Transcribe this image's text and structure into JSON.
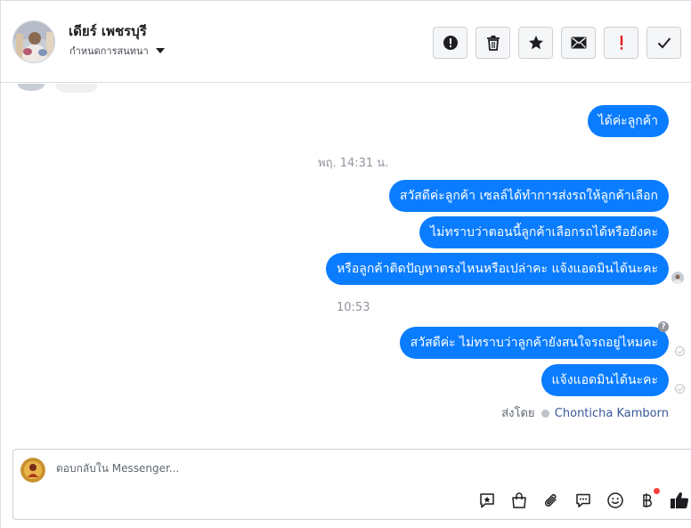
{
  "header": {
    "contact_name": "เดียร์ เพชรบุรี",
    "assign_label": "กำหนดการสนทนา",
    "toolbar": [
      {
        "name": "spam-button",
        "icon": "exclamation-circle-icon"
      },
      {
        "name": "delete-button",
        "icon": "trash-icon"
      },
      {
        "name": "star-button",
        "icon": "star-icon"
      },
      {
        "name": "mark-unread-button",
        "icon": "envelope-icon"
      },
      {
        "name": "important-button",
        "icon": "red-exclamation-icon"
      },
      {
        "name": "done-button",
        "icon": "checkmark-icon"
      }
    ]
  },
  "messages": [
    {
      "text": "ได้ค่ะลูกค้า",
      "from": "page"
    },
    {
      "timestamp": "พฤ. 14:31 น."
    },
    {
      "text": "สวัสดีค่ะลูกค้า เซลล์ได้ทำการส่งรถให้ลูกค้าเลือก",
      "from": "page"
    },
    {
      "text": "ไม่ทราบว่าตอนนี้ลูกค้าเลือกรถได้หรือยังคะ",
      "from": "page"
    },
    {
      "text": "หรือลูกค้าติดปัญหาตรงไหนหรือเปล่าคะ แจ้งแอดมินได้นะคะ",
      "from": "page"
    },
    {
      "timestamp": "10:53"
    },
    {
      "text": "สวัสดีค่ะ ไม่ทราบว่าลูกค้ายังสนใจรถอยู่ไหมคะ",
      "from": "page"
    },
    {
      "text": "แจ้งแอดมินได้นะคะ",
      "from": "page"
    }
  ],
  "sent_by": {
    "prefix": "ส่งโดย",
    "agent_name": "Chonticha Kamborn",
    "help_glyph": "?"
  },
  "composer": {
    "placeholder": "ตอบกลับใน Messenger...",
    "tools": [
      "saved-reply-icon",
      "shopping-bag-icon",
      "paperclip-icon",
      "chat-bubble-icon",
      "emoji-icon",
      "baht-payment-icon",
      "thumbs-up-icon"
    ]
  },
  "colors": {
    "bubble": "#0a7cff",
    "accent": "#385898",
    "important": "#e41e1e",
    "notification": "#fa3e3e"
  }
}
